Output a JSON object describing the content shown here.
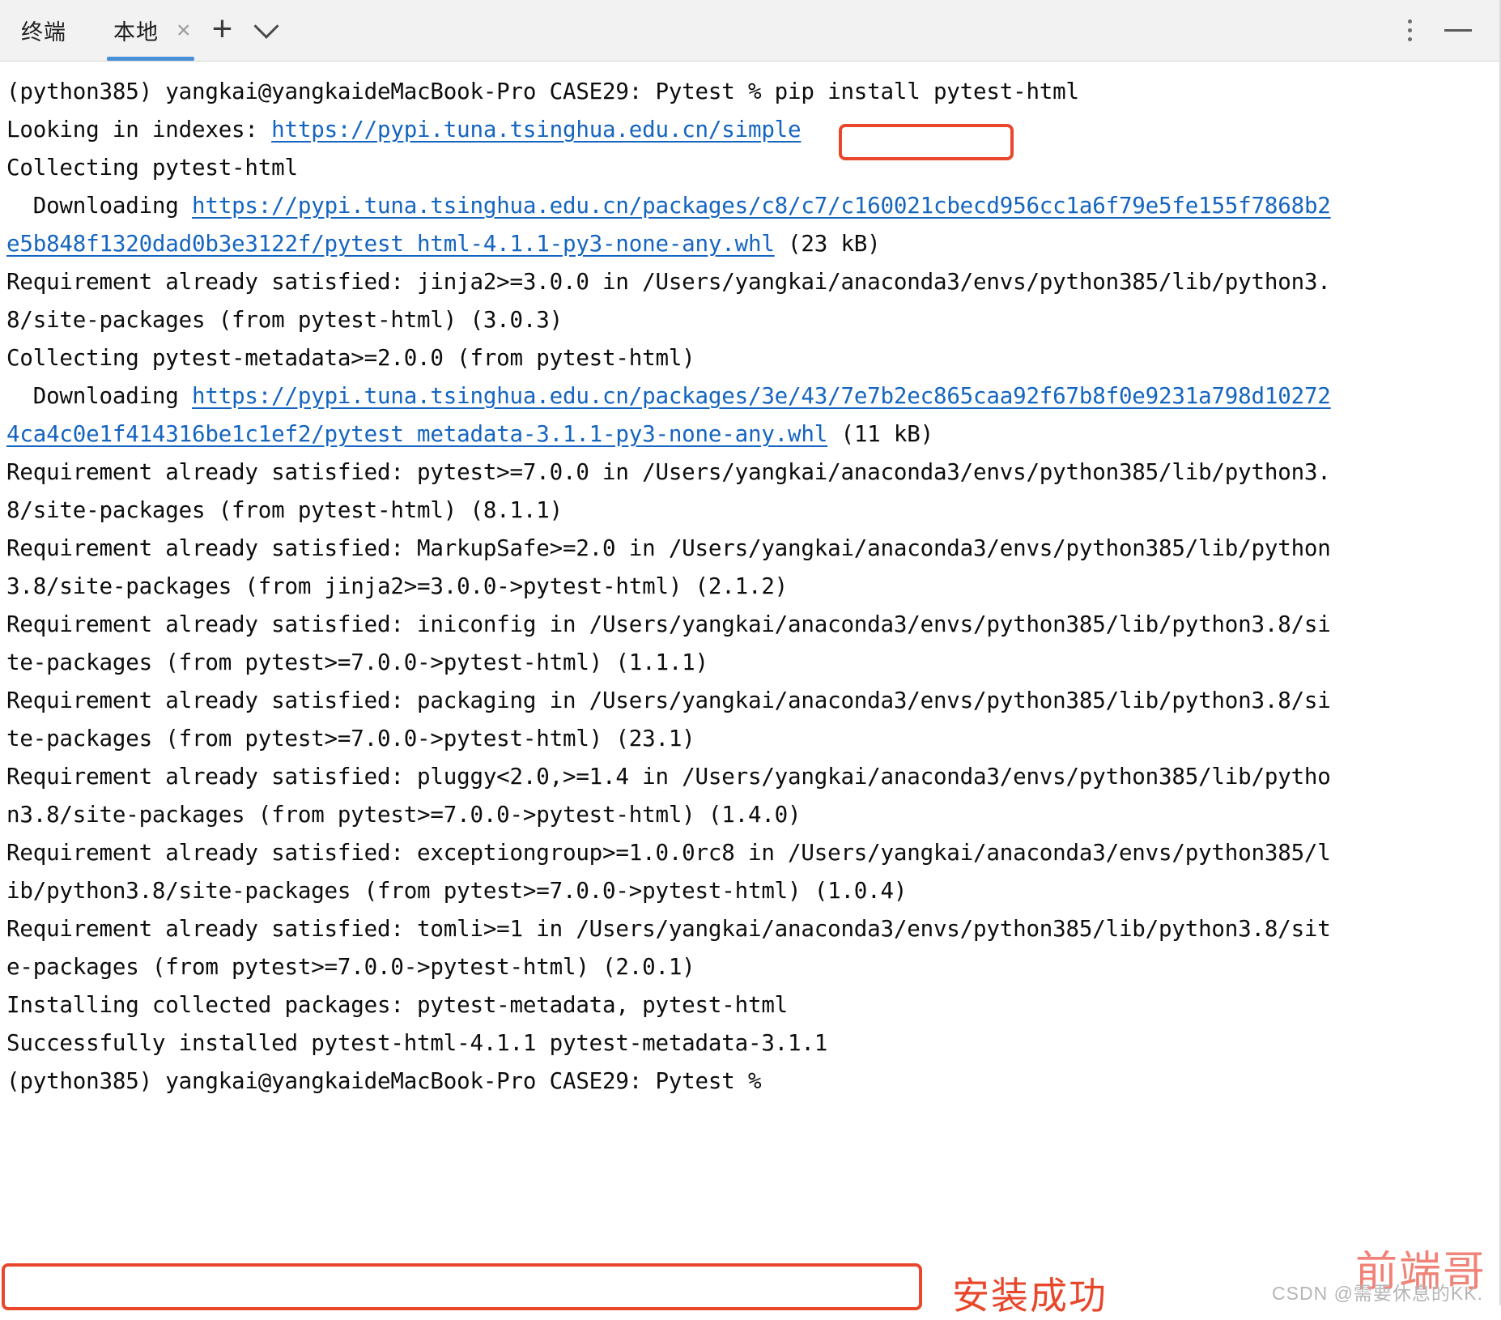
{
  "window": {
    "title": "终端",
    "tab_label": "本地",
    "close_icon": "×",
    "add_icon": "+",
    "dropdown_icon": "chevron-down",
    "menu_icon": "more-vertical",
    "minimize_icon": "minimize"
  },
  "terminal": {
    "lines": [
      [
        {
          "t": "(python385) yangkai@yangkaideMacBook-Pro CASE29: Pytest % pip install pytest-html",
          "link": false
        }
      ],
      [
        {
          "t": "Looking in indexes: ",
          "link": false
        },
        {
          "t": "https://pypi.tuna.tsinghua.edu.cn/simple",
          "link": true
        }
      ],
      [
        {
          "t": "Collecting pytest-html",
          "link": false
        }
      ],
      [
        {
          "t": "  Downloading ",
          "link": false
        },
        {
          "t": "https://pypi.tuna.tsinghua.edu.cn/packages/c8/c7/c160021cbecd956cc1a6f79e5fe155f7868b2",
          "link": true
        }
      ],
      [
        {
          "t": "e5b848f1320dad0b3e3122f/pytest_html-4.1.1-py3-none-any.whl",
          "link": true
        },
        {
          "t": " (23 kB)",
          "link": false
        }
      ],
      [
        {
          "t": "Requirement already satisfied: jinja2>=3.0.0 in /Users/yangkai/anaconda3/envs/python385/lib/python3.",
          "link": false
        }
      ],
      [
        {
          "t": "8/site-packages (from pytest-html) (3.0.3)",
          "link": false
        }
      ],
      [
        {
          "t": "Collecting pytest-metadata>=2.0.0 (from pytest-html)",
          "link": false
        }
      ],
      [
        {
          "t": "  Downloading ",
          "link": false
        },
        {
          "t": "https://pypi.tuna.tsinghua.edu.cn/packages/3e/43/7e7b2ec865caa92f67b8f0e9231a798d10272",
          "link": true
        }
      ],
      [
        {
          "t": "4ca4c0e1f414316be1c1ef2/pytest_metadata-3.1.1-py3-none-any.whl",
          "link": true
        },
        {
          "t": " (11 kB)",
          "link": false
        }
      ],
      [
        {
          "t": "Requirement already satisfied: pytest>=7.0.0 in /Users/yangkai/anaconda3/envs/python385/lib/python3.",
          "link": false
        }
      ],
      [
        {
          "t": "8/site-packages (from pytest-html) (8.1.1)",
          "link": false
        }
      ],
      [
        {
          "t": "Requirement already satisfied: MarkupSafe>=2.0 in /Users/yangkai/anaconda3/envs/python385/lib/python",
          "link": false
        }
      ],
      [
        {
          "t": "3.8/site-packages (from jinja2>=3.0.0->pytest-html) (2.1.2)",
          "link": false
        }
      ],
      [
        {
          "t": "Requirement already satisfied: iniconfig in /Users/yangkai/anaconda3/envs/python385/lib/python3.8/si",
          "link": false
        }
      ],
      [
        {
          "t": "te-packages (from pytest>=7.0.0->pytest-html) (1.1.1)",
          "link": false
        }
      ],
      [
        {
          "t": "Requirement already satisfied: packaging in /Users/yangkai/anaconda3/envs/python385/lib/python3.8/si",
          "link": false
        }
      ],
      [
        {
          "t": "te-packages (from pytest>=7.0.0->pytest-html) (23.1)",
          "link": false
        }
      ],
      [
        {
          "t": "Requirement already satisfied: pluggy<2.0,>=1.4 in /Users/yangkai/anaconda3/envs/python385/lib/pytho",
          "link": false
        }
      ],
      [
        {
          "t": "n3.8/site-packages (from pytest>=7.0.0->pytest-html) (1.4.0)",
          "link": false
        }
      ],
      [
        {
          "t": "Requirement already satisfied: exceptiongroup>=1.0.0rc8 in /Users/yangkai/anaconda3/envs/python385/l",
          "link": false
        }
      ],
      [
        {
          "t": "ib/python3.8/site-packages (from pytest>=7.0.0->pytest-html) (1.0.4)",
          "link": false
        }
      ],
      [
        {
          "t": "Requirement already satisfied: tomli>=1 in /Users/yangkai/anaconda3/envs/python385/lib/python3.8/sit",
          "link": false
        }
      ],
      [
        {
          "t": "e-packages (from pytest>=7.0.0->pytest-html) (2.0.1)",
          "link": false
        }
      ],
      [
        {
          "t": "Installing collected packages: pytest-metadata, pytest-html",
          "link": false
        }
      ],
      [
        {
          "t": "Successfully installed pytest-html-4.1.1 pytest-metadata-3.1.1",
          "link": false
        }
      ],
      [
        {
          "t": "(python385) yangkai@yangkaideMacBook-Pro CASE29: Pytest % ",
          "link": false
        }
      ]
    ]
  },
  "annotations": {
    "command_box_color": "#e8472c",
    "success_box_color": "#e8472c",
    "success_note": "安装成功"
  },
  "watermark": {
    "red": "前端哥",
    "gray": "CSDN @需要休息的KK."
  }
}
